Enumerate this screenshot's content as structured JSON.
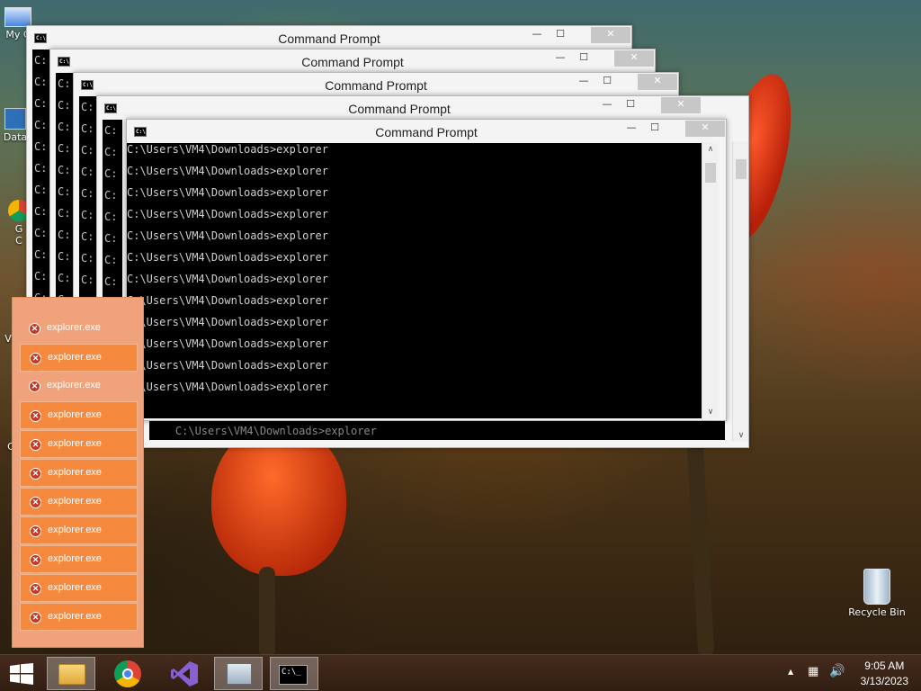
{
  "desktop": {
    "icons": [
      {
        "label": "My C"
      },
      {
        "label": "Data"
      },
      {
        "label": "G"
      },
      {
        "label": "C"
      },
      {
        "label": "V"
      },
      {
        "label": "C"
      },
      {
        "label": "Recycle Bin"
      }
    ]
  },
  "cmd_windows": [
    {
      "title": "Command Prompt",
      "min": "—",
      "max": "☐",
      "close": "✕"
    },
    {
      "title": "Command Prompt",
      "min": "—",
      "max": "☐",
      "close": "✕"
    },
    {
      "title": "Command Prompt",
      "min": "—",
      "max": "☐",
      "close": "✕"
    },
    {
      "title": "Command Prompt",
      "min": "—",
      "max": "☐",
      "close": "✕"
    },
    {
      "title": "Command Prompt",
      "min": "—",
      "max": "☐",
      "close": "✕"
    }
  ],
  "console": {
    "side_prefix": "C:",
    "lines": [
      "C:\\Users\\VM4\\Downloads>explorer",
      "C:\\Users\\VM4\\Downloads>explorer",
      "C:\\Users\\VM4\\Downloads>explorer",
      "C:\\Users\\VM4\\Downloads>explorer",
      "C:\\Users\\VM4\\Downloads>explorer",
      "C:\\Users\\VM4\\Downloads>explorer",
      "C:\\Users\\VM4\\Downloads>explorer",
      "C:\\Users\\VM4\\Downloads>explorer",
      "C:\\Users\\VM4\\Downloads>explorer",
      "C:\\Users\\VM4\\Downloads>explorer",
      "C:\\Users\\VM4\\Downloads>explorer",
      "C:\\Users\\VM4\\Downloads>explorer"
    ],
    "back_partial_line": "C:\\Users\\VM4\\Downloads>explorer"
  },
  "errors": [
    {
      "label": "explorer.exe"
    },
    {
      "label": "explorer.exe"
    },
    {
      "label": "explorer.exe"
    },
    {
      "label": "explorer.exe"
    },
    {
      "label": "explorer.exe"
    },
    {
      "label": "explorer.exe"
    },
    {
      "label": "explorer.exe"
    },
    {
      "label": "explorer.exe"
    },
    {
      "label": "explorer.exe"
    },
    {
      "label": "explorer.exe"
    },
    {
      "label": "explorer.exe"
    }
  ],
  "taskbar": {
    "start_icon": "windows-logo",
    "pinned": [
      "file-explorer",
      "chrome",
      "visual-studio",
      "resource-monitor",
      "command-prompt"
    ],
    "clock_time": "9:05 AM",
    "clock_date": "3/13/2023"
  },
  "colors": {
    "error_panel": "#f0a27a",
    "error_highlight": "#f58a3f",
    "close_button": "#c7c7c7"
  }
}
